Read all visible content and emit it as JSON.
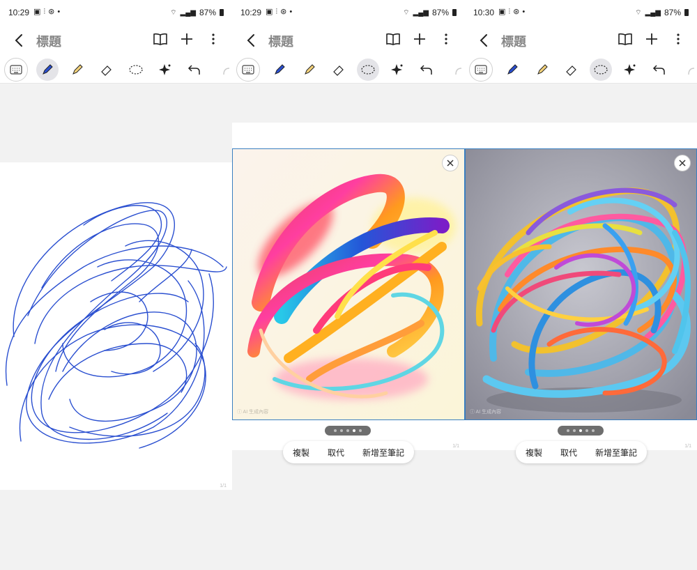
{
  "panels": [
    {
      "status": {
        "time": "10:29",
        "battery": "87%"
      },
      "title": "標題",
      "page_no": "1/1"
    },
    {
      "status": {
        "time": "10:29",
        "battery": "87%"
      },
      "title": "標題",
      "page_no": "1/1",
      "watermark": "ⓘ AI 生成內容",
      "actions": {
        "copy": "複製",
        "replace": "取代",
        "add": "新增至筆記"
      },
      "page_dots": {
        "count": 5,
        "active": 4
      }
    },
    {
      "status": {
        "time": "10:30",
        "battery": "87%"
      },
      "title": "標題",
      "page_no": "1/1",
      "watermark": "ⓘ AI 生成內容",
      "actions": {
        "copy": "複製",
        "replace": "取代",
        "add": "新增至筆記"
      },
      "page_dots": {
        "count": 5,
        "active": 3
      }
    }
  ],
  "colors": {
    "pen": "#2a4fd0",
    "accent": "#3a7fc0"
  },
  "icons": [
    "keyboard-icon",
    "pen-icon",
    "highlighter-icon",
    "eraser-icon",
    "lasso-icon",
    "sparkle-icon",
    "undo-icon",
    "redo-icon",
    "book-icon",
    "plus-icon",
    "more-icon",
    "back-icon"
  ]
}
